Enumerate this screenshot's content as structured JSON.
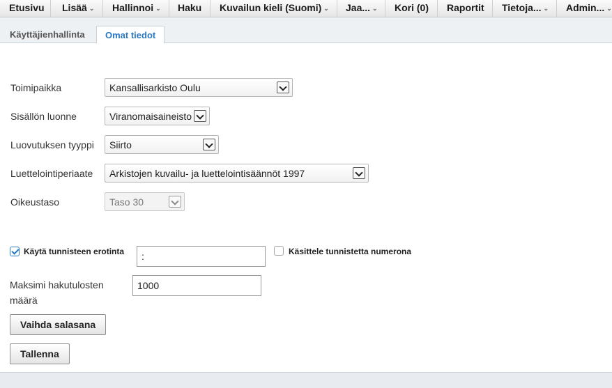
{
  "menu": {
    "items": [
      {
        "label": "Etusivu",
        "caret": ""
      },
      {
        "label": "Lisää",
        "caret": "⌄"
      },
      {
        "label": "Hallinnoi",
        "caret": "⌄"
      },
      {
        "label": "Haku",
        "caret": ""
      },
      {
        "label": "Kuvailun kieli (Suomi)",
        "caret": "⌄"
      },
      {
        "label": "Jaa...",
        "caret": "⌄"
      },
      {
        "label": "Kori (0)",
        "caret": ""
      },
      {
        "label": "Raportit",
        "caret": ""
      },
      {
        "label": "Tietoja...",
        "caret": "⌄"
      },
      {
        "label": "Admin...",
        "caret": "⌄"
      }
    ]
  },
  "tabs": [
    {
      "label": "Käyttäjienhallinta",
      "active": false
    },
    {
      "label": "Omat tiedot",
      "active": true
    }
  ],
  "form": {
    "toimipaikka": {
      "label": "Toimipaikka",
      "value": "Kansallisarkisto Oulu"
    },
    "sisallon_luonne": {
      "label": "Sisällön luonne",
      "value": "Viranomaisaineisto"
    },
    "luovutuksen_tyyppi": {
      "label": "Luovutuksen tyyppi",
      "value": "Siirto"
    },
    "luettelointiperiaate": {
      "label": "Luettelointiperiaate",
      "value": "Arkistojen kuvailu- ja luettelointisäännöt 1997"
    },
    "oikeustaso": {
      "label": "Oikeustaso",
      "value": "Taso 30",
      "disabled": true
    },
    "tunniste_erotin": {
      "label": "Käytä tunnisteen erotinta",
      "checked": true,
      "value": ":"
    },
    "tunniste_numero": {
      "label": "Käsittele tunnistetta numerona",
      "checked": false
    },
    "maksimi_hakutulokset": {
      "label_line1": "Maksimi hakutulosten",
      "label_line2": "määrä",
      "value": "1000"
    }
  },
  "buttons": {
    "change_password": "Vaihda salasana",
    "save": "Tallenna"
  },
  "colors": {
    "accent": "#2a78c2",
    "menubar": "#eeeeee",
    "tabrow": "#eef1f4"
  }
}
